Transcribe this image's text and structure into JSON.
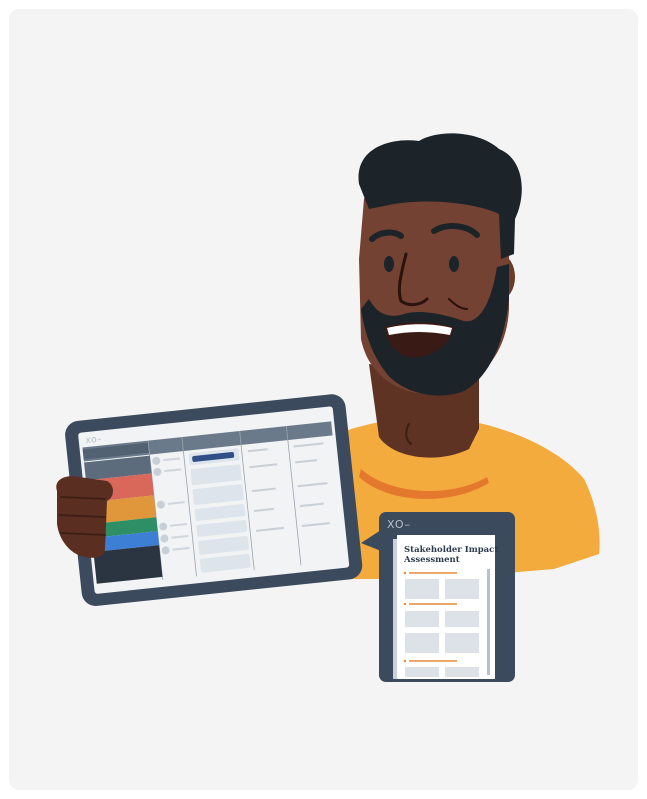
{
  "tablet": {
    "logo": "XO–",
    "sidebar_colors": [
      "#5d6c7d",
      "#d9675a",
      "#e0963a",
      "#2e8f67",
      "#3e7fd6",
      "#2b3542"
    ]
  },
  "document": {
    "logo": "XO–",
    "title_line1": "Stakeholder Impact",
    "title_line2": "Assessment"
  },
  "colors": {
    "background": "#f4f4f4",
    "shirt": "#f4ab3e",
    "skin": "#6b3b2a",
    "hair": "#1c2329",
    "device_frame": "#3b4a5d",
    "accent_orange": "#e88a38"
  }
}
